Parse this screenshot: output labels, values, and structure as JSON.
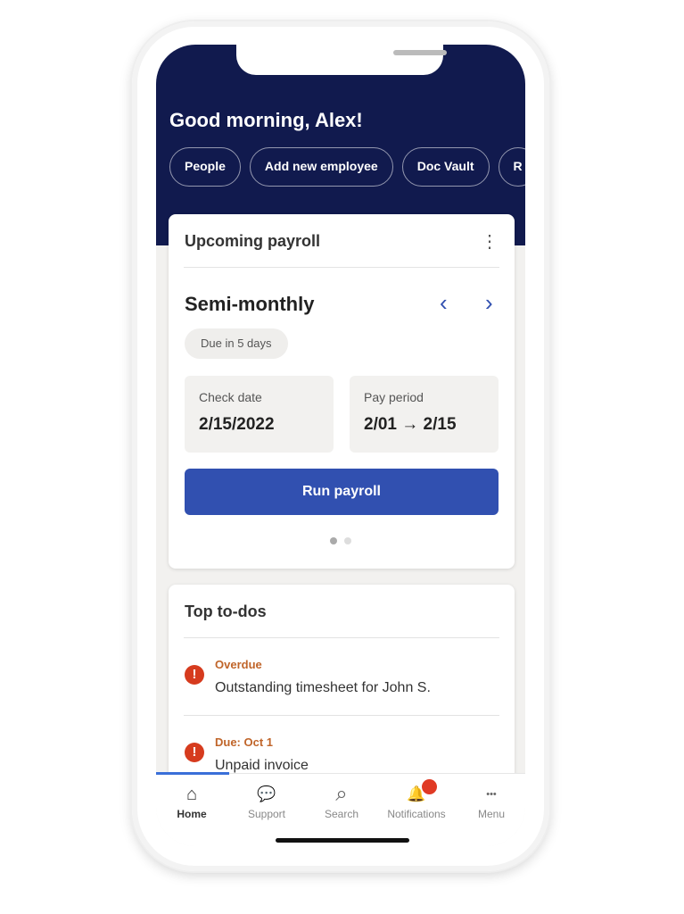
{
  "greeting": "Good morning, Alex!",
  "chips": [
    "People",
    "Add new employee",
    "Doc Vault",
    "R"
  ],
  "payroll": {
    "title": "Upcoming payroll",
    "frequency": "Semi-monthly",
    "due": "Due in 5 days",
    "check_label": "Check date",
    "check_value": "2/15/2022",
    "period_label": "Pay period",
    "period_value": "2/01 → 2/15",
    "run_label": "Run payroll",
    "prev": "‹",
    "next": "›",
    "menu": "⋮"
  },
  "todos": {
    "title": "Top to-dos",
    "items": [
      {
        "status": "Overdue",
        "text": "Outstanding timesheet for John S."
      },
      {
        "status": "Due: Oct 1",
        "text": "Unpaid invoice"
      }
    ]
  },
  "nav": [
    {
      "label": "Home",
      "icon": "home-icon",
      "glyph": "⌂"
    },
    {
      "label": "Support",
      "icon": "support-icon",
      "glyph": "💬"
    },
    {
      "label": "Search",
      "icon": "search-icon",
      "glyph": "⌕"
    },
    {
      "label": "Notifications",
      "icon": "bell-icon",
      "glyph": "🔔"
    },
    {
      "label": "Menu",
      "icon": "more-icon",
      "glyph": "•••"
    }
  ],
  "colors": {
    "header": "#111a4e",
    "accent": "#3150b0",
    "alert": "#d63b1e"
  }
}
